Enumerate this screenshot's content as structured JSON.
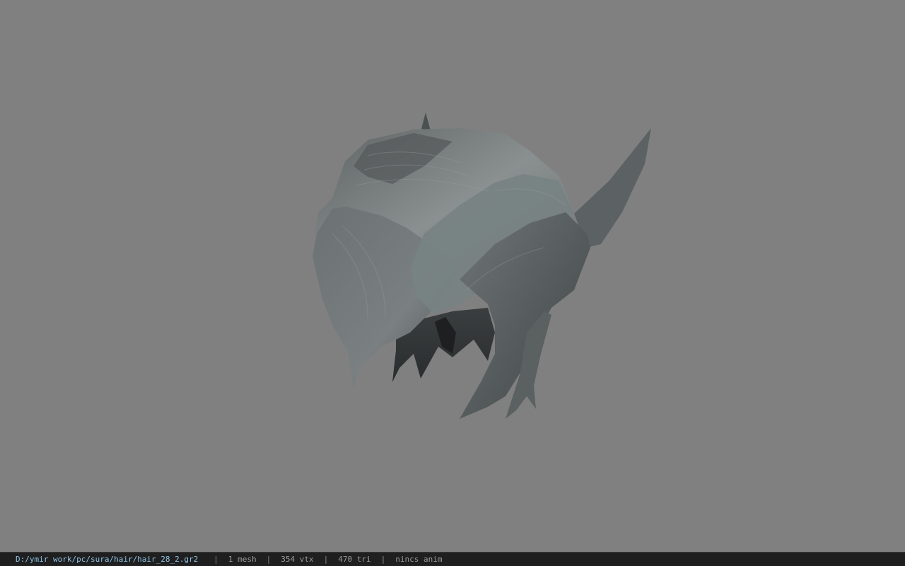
{
  "viewport": {
    "background": "#808080",
    "model": "hair mesh"
  },
  "status": {
    "file_path": "D:/ymir work/pc/sura/hair/hair_28_2.gr2",
    "separator": "|",
    "mesh_count": "1 mesh",
    "vertex_count": "354 vtx",
    "triangle_count": "470 tri",
    "anim_state": "nincs anim"
  }
}
